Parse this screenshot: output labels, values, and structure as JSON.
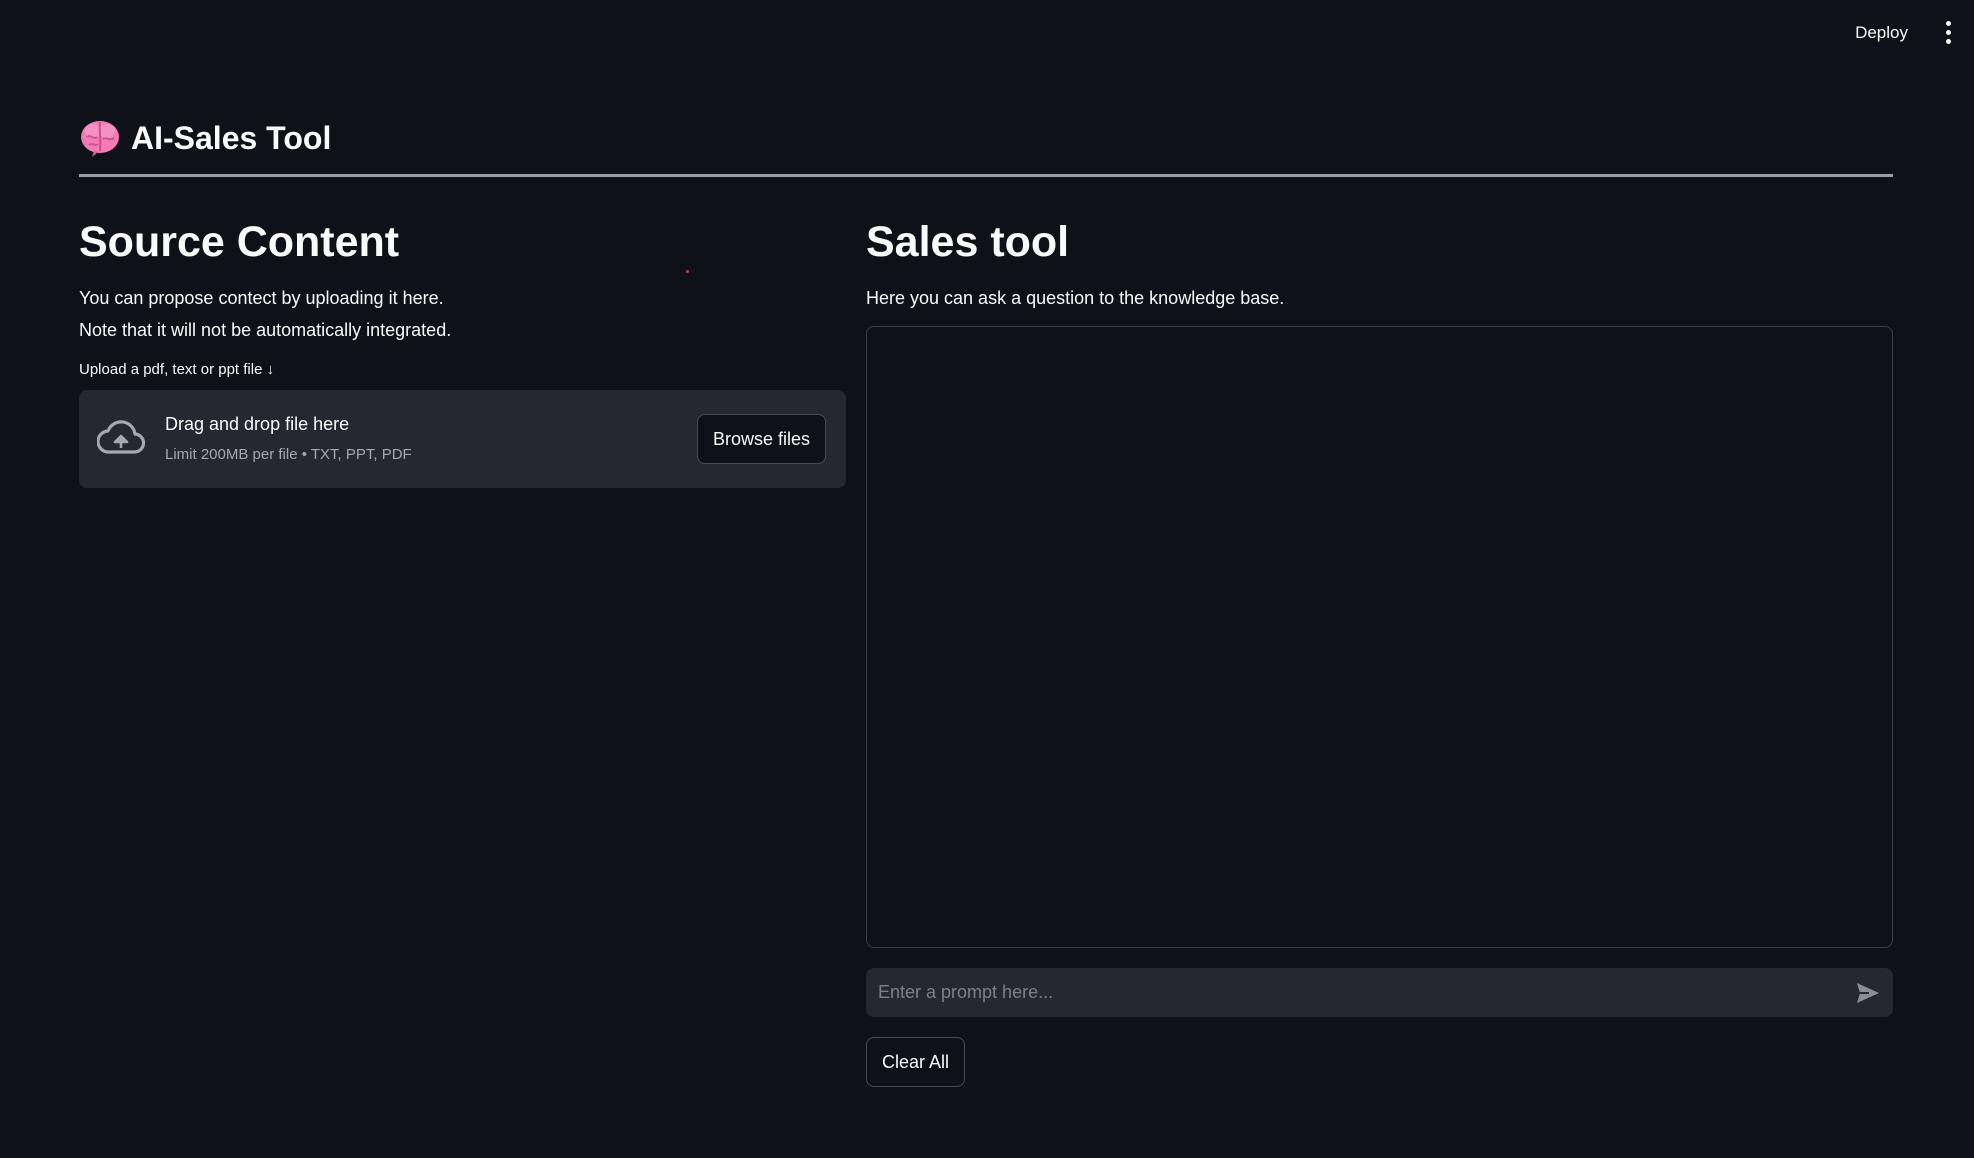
{
  "toolbar": {
    "deploy_label": "Deploy",
    "menu_icon": "kebab-menu-icon"
  },
  "header": {
    "icon": "brain-icon",
    "title": "AI-Sales Tool"
  },
  "source": {
    "heading": "Source Content",
    "line1": "You can propose contect by uploading it here.",
    "line2": "Note that it will not be automatically integrated.",
    "upload_label": "Upload a pdf, text or ppt file ↓",
    "dropzone": {
      "icon": "cloud-upload-icon",
      "title": "Drag and drop file here",
      "subtitle": "Limit 200MB per file • TXT, PPT, PDF",
      "browse_label": "Browse files"
    }
  },
  "sales": {
    "heading": "Sales tool",
    "description": "Here you can ask a question to the knowledge base.",
    "prompt_placeholder": "Enter a prompt here...",
    "send_icon": "send-icon",
    "clear_label": "Clear All"
  },
  "colors": {
    "background": "#0e1117",
    "surface": "#262730",
    "text": "#fafafa",
    "muted": "#a3a8b4",
    "brain": "#f27bb5"
  }
}
